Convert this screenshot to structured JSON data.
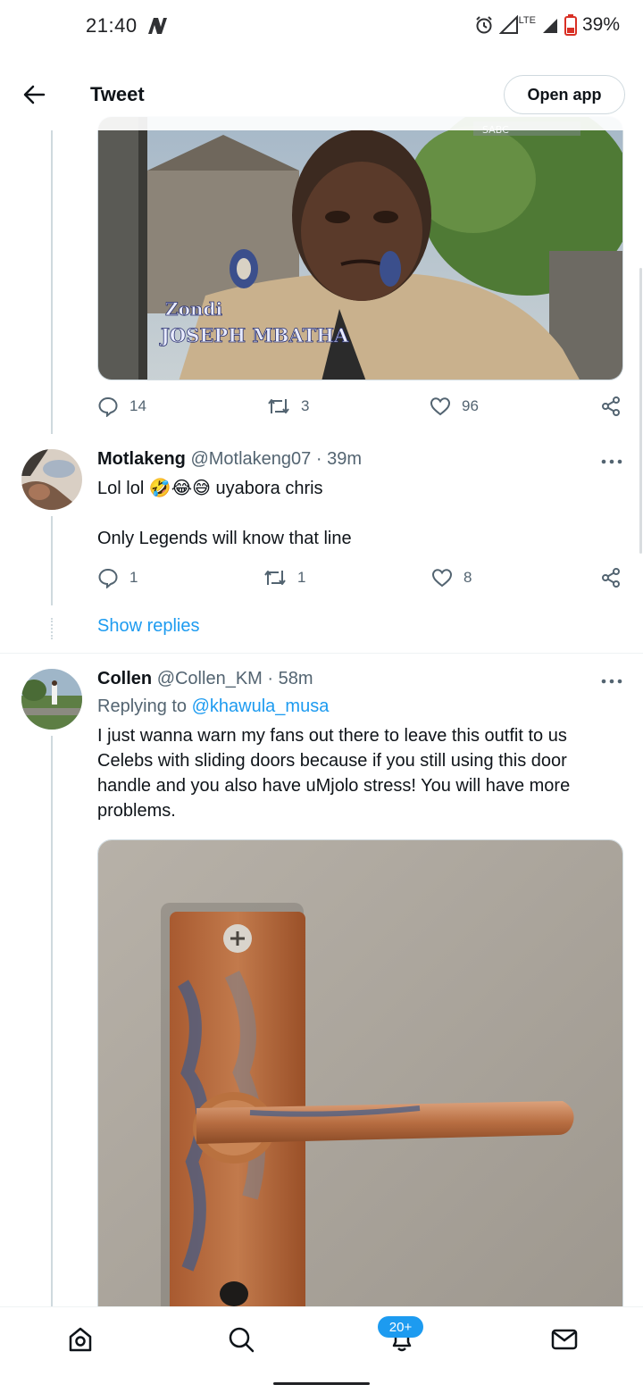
{
  "status_bar": {
    "time": "21:40",
    "battery": "39%",
    "network": "LTE",
    "icons": [
      "n-app-icon",
      "alarm-icon",
      "signal-icon",
      "battery-low-icon"
    ]
  },
  "header": {
    "title": "Tweet",
    "open_app_label": "Open app",
    "back_icon": "arrow-left-icon"
  },
  "top_media": {
    "caption_line1": "Zondi",
    "caption_line2": "JOSEPH MBATHA",
    "watermark": "SABC"
  },
  "top_tweet_actions": {
    "replies": "14",
    "retweets": "3",
    "likes": "96"
  },
  "reply_1": {
    "name": "Motlakeng",
    "handle": "@Motlakeng07",
    "time": "· 39m",
    "text_line1": "Lol lol 🤣😂😅 uyabora chris",
    "text_line2": "Only Legends will know that line",
    "replies": "1",
    "retweets": "1",
    "likes": "8",
    "show_replies": "Show replies"
  },
  "reply_2": {
    "name": "Collen",
    "handle": "@Collen_KM",
    "time": "· 58m",
    "replying_prefix": "Replying to",
    "replying_to": "@khawula_musa",
    "text": "I just wanna warn my fans out there to leave this outfit to us Celebs with sliding doors because if you still using this door handle and you also have uMjolo stress! You will have more problems."
  },
  "bottom_nav": {
    "items": [
      "home-icon",
      "search-icon",
      "notifications-icon",
      "messages-icon"
    ],
    "notification_badge": "20+"
  },
  "colors": {
    "accent": "#1d9bf0",
    "text": "#0f1419",
    "secondary": "#536471",
    "border": "#cfd9de"
  }
}
